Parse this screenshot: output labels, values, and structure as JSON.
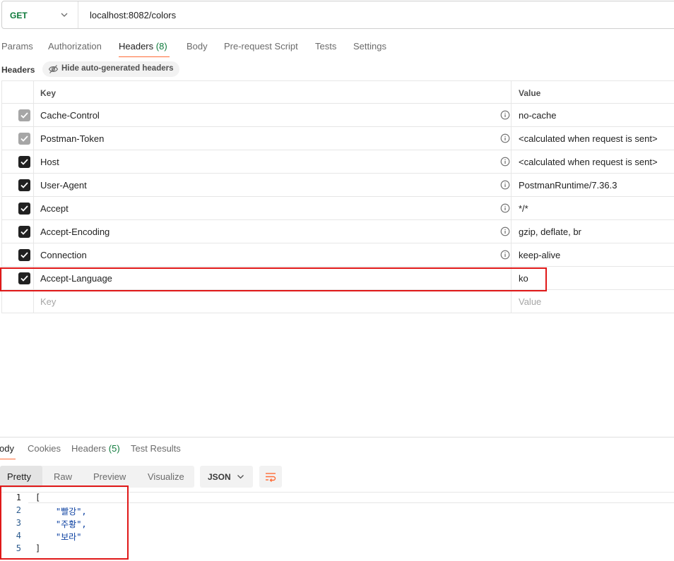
{
  "request": {
    "method": "GET",
    "url": "localhost:8082/colors"
  },
  "request_tabs": [
    {
      "label": "Params",
      "count": "",
      "active": false
    },
    {
      "label": "Authorization",
      "count": "",
      "active": false
    },
    {
      "label": "Headers",
      "count": "(8)",
      "active": true
    },
    {
      "label": "Body",
      "count": "",
      "active": false
    },
    {
      "label": "Pre-request Script",
      "count": "",
      "active": false
    },
    {
      "label": "Tests",
      "count": "",
      "active": false
    },
    {
      "label": "Settings",
      "count": "",
      "active": false
    }
  ],
  "headers_section": {
    "title": "Headers",
    "toggle_label": "Hide auto-generated headers"
  },
  "table": {
    "columns": [
      "Key",
      "Value"
    ],
    "rows": [
      {
        "key": "Cache-Control",
        "value": "no-cache",
        "checked": true,
        "auto": true,
        "info": true
      },
      {
        "key": "Postman-Token",
        "value": "<calculated when request is sent>",
        "checked": true,
        "auto": true,
        "info": true
      },
      {
        "key": "Host",
        "value": "<calculated when request is sent>",
        "checked": true,
        "auto": false,
        "info": true
      },
      {
        "key": "User-Agent",
        "value": "PostmanRuntime/7.36.3",
        "checked": true,
        "auto": false,
        "info": true
      },
      {
        "key": "Accept",
        "value": "*/*",
        "checked": true,
        "auto": false,
        "info": true
      },
      {
        "key": "Accept-Encoding",
        "value": "gzip, deflate, br",
        "checked": true,
        "auto": false,
        "info": true
      },
      {
        "key": "Connection",
        "value": "keep-alive",
        "checked": true,
        "auto": false,
        "info": true
      },
      {
        "key": "Accept-Language",
        "value": "ko",
        "checked": true,
        "auto": false,
        "info": false
      }
    ],
    "new_row": {
      "key_placeholder": "Key",
      "value_placeholder": "Value"
    }
  },
  "response_tabs": [
    {
      "label": "ody",
      "count": "",
      "active": true
    },
    {
      "label": "Cookies",
      "count": "",
      "active": false
    },
    {
      "label": "Headers",
      "count": "(5)",
      "active": false
    },
    {
      "label": "Test Results",
      "count": "",
      "active": false
    }
  ],
  "view_tabs": [
    "Pretty",
    "Raw",
    "Preview",
    "Visualize"
  ],
  "format_select": "JSON",
  "code_lines": [
    {
      "num": "1",
      "text": "[",
      "is_string": false
    },
    {
      "num": "2",
      "text": "    \"빨강\",",
      "is_string": true
    },
    {
      "num": "3",
      "text": "    \"주황\",",
      "is_string": true
    },
    {
      "num": "4",
      "text": "    \"보라\"",
      "is_string": true
    },
    {
      "num": "5",
      "text": "]",
      "is_string": false
    }
  ],
  "colors": {
    "accent": "#ff6c37",
    "method": "#0e7a3b",
    "highlight": "#e01818"
  }
}
